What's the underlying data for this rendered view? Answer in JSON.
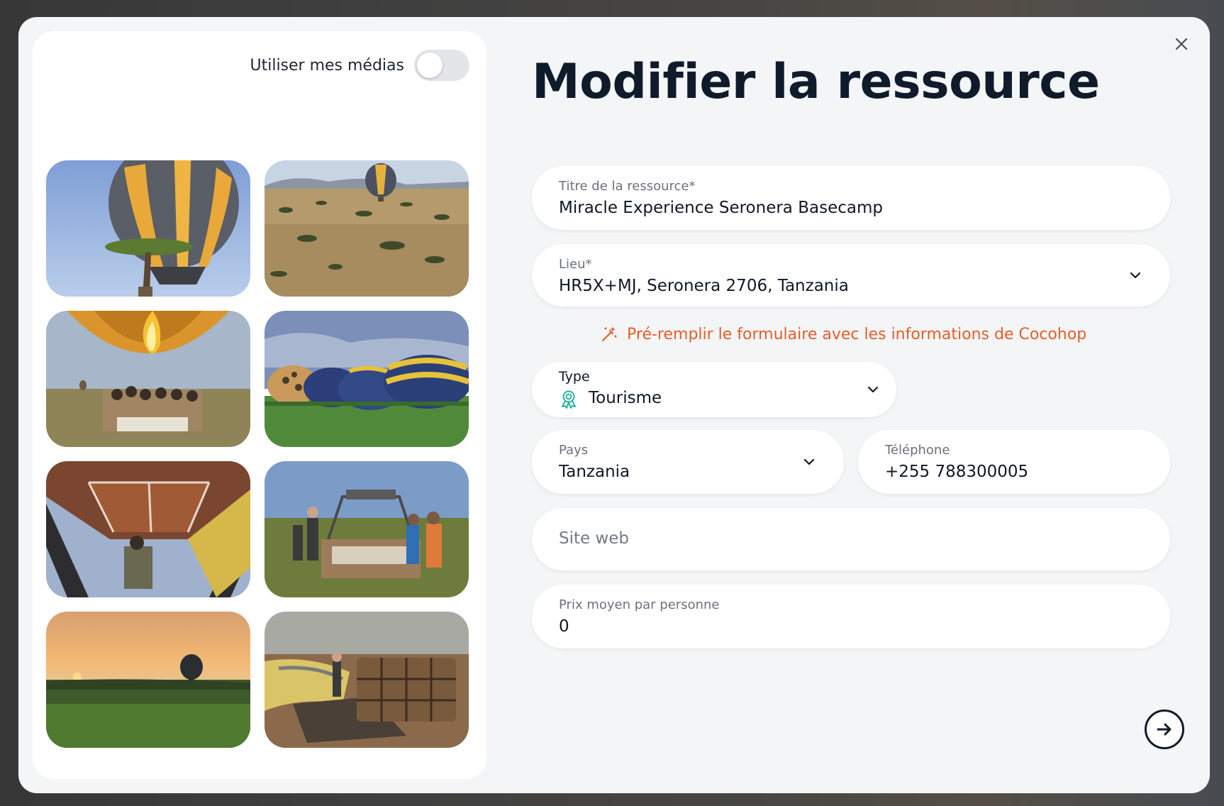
{
  "modal": {
    "title": "Modifier la ressource",
    "close_icon": "close-icon"
  },
  "media": {
    "toggle_label": "Utiliser mes médias",
    "toggle_on": false,
    "photos": [
      {
        "name": "balloon-over-acacia"
      },
      {
        "name": "balloon-over-savanna"
      },
      {
        "name": "balloon-basket-with-flame"
      },
      {
        "name": "balloons-inflating-on-grass"
      },
      {
        "name": "inside-balloon-envelope"
      },
      {
        "name": "basket-with-pilots"
      },
      {
        "name": "sunset-balloon"
      },
      {
        "name": "deflated-balloon-basket"
      }
    ]
  },
  "form": {
    "title_field": {
      "label": "Titre de la ressource*",
      "value": "Miracle Experience Seronera Basecamp"
    },
    "location_field": {
      "label": "Lieu*",
      "value": "HR5X+MJ, Seronera 2706, Tanzania"
    },
    "prefill_text": "Pré-remplir le formulaire avec les informations de Cocohop",
    "type_field": {
      "label": "Type",
      "value": "Tourisme",
      "icon": "rosette-icon"
    },
    "country_field": {
      "label": "Pays",
      "value": "Tanzania"
    },
    "phone_field": {
      "label": "Téléphone",
      "value": "+255 788300005"
    },
    "website_field": {
      "placeholder": "Site web"
    },
    "price_field": {
      "label": "Prix moyen par personne",
      "value": "0"
    }
  },
  "colors": {
    "accent": "#e35d2a",
    "type_icon": "#2bb3a3",
    "text_dark": "#0f1b2b"
  }
}
